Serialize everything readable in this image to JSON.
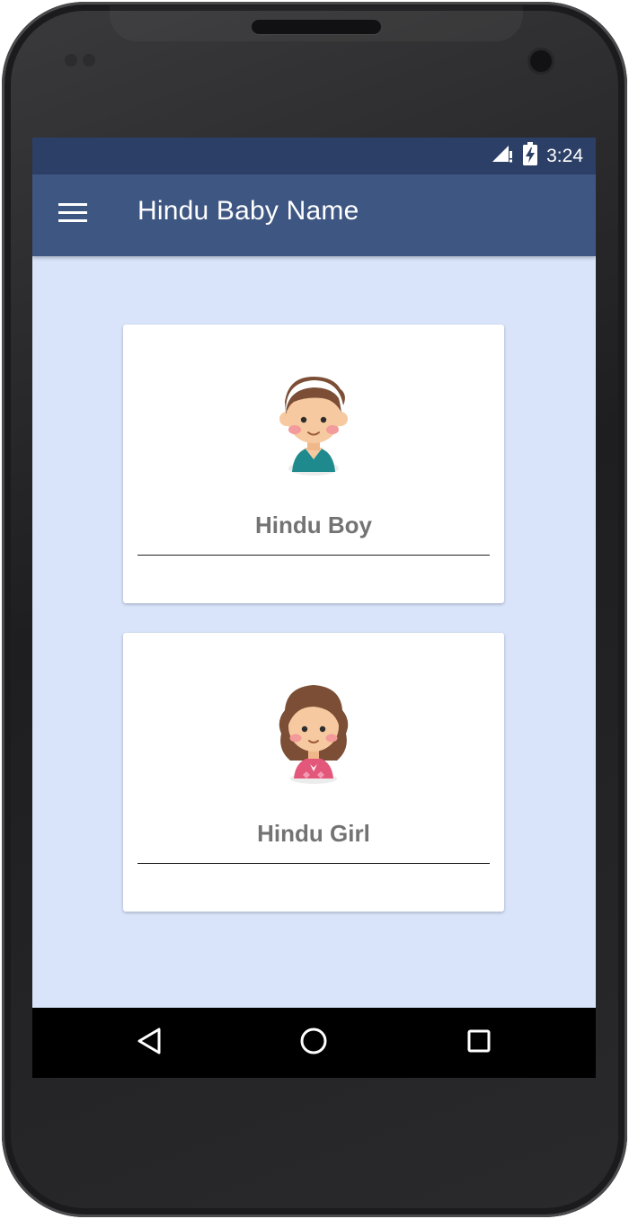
{
  "status_bar": {
    "time": "3:24",
    "signal_icon": "signal-no-data-icon",
    "battery_icon": "battery-charging-icon"
  },
  "app_bar": {
    "title": "Hindu Baby Name",
    "menu_icon": "hamburger-menu-icon"
  },
  "cards": [
    {
      "label": "Hindu Boy",
      "avatar": "boy-avatar-icon"
    },
    {
      "label": "Hindu Girl",
      "avatar": "girl-avatar-icon"
    }
  ],
  "nav_bar": {
    "back_icon": "back-triangle-icon",
    "home_icon": "home-circle-icon",
    "recents_icon": "recents-square-icon"
  },
  "colors": {
    "status_bar": "#2c3f66",
    "app_bar": "#3e5682",
    "screen_background": "#d9e4fb",
    "card_label": "#737373"
  }
}
